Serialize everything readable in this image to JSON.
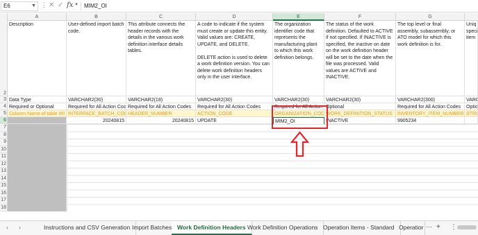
{
  "formula_bar": {
    "cell_ref": "E6",
    "fx_label": "fx",
    "formula_value": "MIM2_OI"
  },
  "columns": [
    "A",
    "B",
    "C",
    "D",
    "E",
    "F",
    "G"
  ],
  "rows": [
    "2",
    "3",
    "4",
    "5",
    "6",
    "7",
    "8",
    "9",
    "10",
    "11",
    "12",
    "13",
    "14",
    "15",
    "16",
    "17",
    "18"
  ],
  "cells": {
    "A2": "Description",
    "B2": "User-defined import batch code.",
    "C2": "This attribute connects the header records with the details in the various work definition interface details tables.",
    "D2": "A code to indicate if the system must create or update this entity. Valid values are: CREATE, UPDATE, and DELETE.\n\nDELETE action is used to delete a work definition version. You can delete work definition headers only in the user interface.",
    "E2": "The organization identifier code that represents the manufacturing plant to which this work definition belongs.",
    "F2": "The status of the work definition. Defaulted to ACTIVE if not specified. If INACTIVE is specified, the inactive on date on the work definition header will be set to the date when the file was processed. Valid values are ACTIVE and INACTIVE.",
    "G2": "The top level or final assembly, subassembly, or ATO model for which this work definition is for.",
    "H2": "Uniq speci item",
    "A3": "Data Type",
    "B3": "VARCHAR2(30)",
    "C3": "VARCHAR2(18)",
    "D3": "VARCHAR2(30)",
    "E3": "VARCHAR2(30)",
    "F3": "VARCHAR2(30)",
    "G3": "VARCHAR2(300)",
    "H3": "VARC",
    "A4": "Required or Optional",
    "B4": "Required for All Action Coc",
    "C4": "Required for All Action Codes",
    "D4": "Required for All Action Codes",
    "E4": "Required for All Action Codes",
    "F4": "Optional",
    "G4": "Required for All Action Codes",
    "H4": "Optio",
    "A5": "Column Name of table WI",
    "B5": "INTERFACE_BATCH_CODE",
    "C5": "HEADER_NUMBER",
    "D5": "ACTION_CODE",
    "E5": "ORGANIZATION_CODE",
    "F5": "WORK_DEFINITION_STATUS",
    "G5": "INVENTORY_ITEM_NUMBER",
    "H5": "STRU",
    "B6": "20240815",
    "C6": "20240815",
    "D6": "UPDATE",
    "E6": "MIM2_OI",
    "F6": "INACTIVE",
    "G6": "9905234"
  },
  "tabs": [
    {
      "label": "Instructions and CSV Generation"
    },
    {
      "label": "Import Batches"
    },
    {
      "label": "Work Definition Headers"
    },
    {
      "label": "Work Definition Operations"
    },
    {
      "label": "Operation Items - Standard"
    },
    {
      "label": "Operatior"
    }
  ],
  "active_tab": "Work Definition Headers",
  "colors": {
    "accent": "#217346",
    "highlight_row": "#fff6cc",
    "orange_text": "#e69a2e",
    "annotation": "#e4262b"
  }
}
